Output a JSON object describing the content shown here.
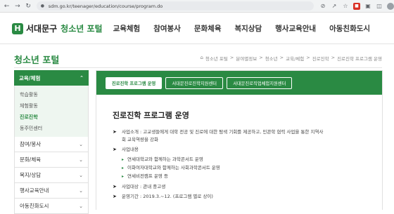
{
  "browser": {
    "url": "sdm.go.kr/teenager/education/course/program.do"
  },
  "header": {
    "logo_mark": "H",
    "logo_main": "서대문구",
    "logo_sub": "청소년 포털",
    "nav": [
      "교육체험",
      "참여봉사",
      "문화체육",
      "복지상담",
      "행사교육안내",
      "아동친화도시"
    ]
  },
  "page": {
    "title": "청소년 포털",
    "breadcrumb": [
      "청소년 포털",
      "분야별정보",
      "청소년",
      "교육/체험",
      "진로진학",
      "진로진학 프로그램 운영"
    ]
  },
  "sidebar": {
    "active_section": "교육/체험",
    "sub_items": [
      {
        "label": "학습활동",
        "active": false
      },
      {
        "label": "체험활동",
        "active": false
      },
      {
        "label": "진로진학",
        "active": true
      },
      {
        "label": "동주민센터",
        "active": false
      }
    ],
    "sections": [
      "참여/봉사",
      "문화/체육",
      "복지/상담",
      "행사교육안내",
      "아동친화도시"
    ]
  },
  "content": {
    "tabs": [
      {
        "label": "진로진학 프로그램 운영",
        "active": true
      },
      {
        "label": "서대문진로진학지원센터",
        "active": false
      },
      {
        "label": "서대문진로직업체험지원센터",
        "active": false
      }
    ],
    "title": "진로진학 프로그램 운영",
    "intro_line1": "사업소개 : 고교생들에게 대학 전공 및 진로에 대한 탐색 기회를 제공하고, 민관학 협력 사업을 통한 지역사",
    "intro_line2": "회 교육역량을 강화",
    "contents_label": "사업내용",
    "contents_items": [
      "연세대학교와 함께하는 과학콘서트 운영",
      "이화여자대학교와 함께하는 사회과학콘서트 운영",
      "연세비전캠프 운영 등"
    ],
    "target": "사업대상 : 관내 중고생",
    "period": "운영기간 : 2019.3.~12. (프로그램 별로 상이)"
  }
}
